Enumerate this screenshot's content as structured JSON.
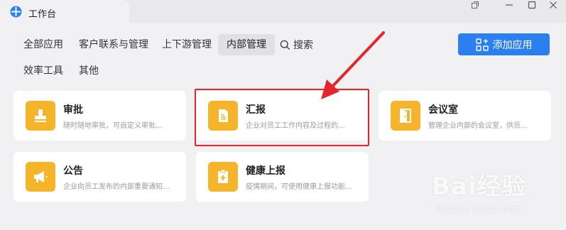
{
  "window": {
    "title": "工作台"
  },
  "nav": {
    "tabs": [
      {
        "label": "全部应用",
        "active": false
      },
      {
        "label": "客户联系与管理",
        "active": false
      },
      {
        "label": "上下游管理",
        "active": false
      },
      {
        "label": "内部管理",
        "active": true
      },
      {
        "label": "效率工具",
        "active": false
      },
      {
        "label": "其他",
        "active": false
      }
    ],
    "search_label": "搜索",
    "add_button_label": "添加应用"
  },
  "apps": [
    {
      "title": "审批",
      "desc": "随时随地审批，可自定义审批...",
      "icon": "stamp-icon"
    },
    {
      "title": "汇报",
      "desc": "企业对员工工作内容及过程的...",
      "icon": "report-icon"
    },
    {
      "title": "会议室",
      "desc": "管理企业内部的会议室，供员...",
      "icon": "door-icon"
    },
    {
      "title": "公告",
      "desc": "企业向员工发布的内部重要通知...",
      "icon": "megaphone-icon"
    },
    {
      "title": "健康上报",
      "desc": "疫情期间，可使用健康上报功能...",
      "icon": "health-clipboard-icon"
    }
  ],
  "colors": {
    "accent": "#2b7fef",
    "app_icon": "#f5b42a",
    "highlight": "#e4262c"
  },
  "watermark": {
    "brand": "Bai经验",
    "url": "jingyan.baidu.com"
  }
}
